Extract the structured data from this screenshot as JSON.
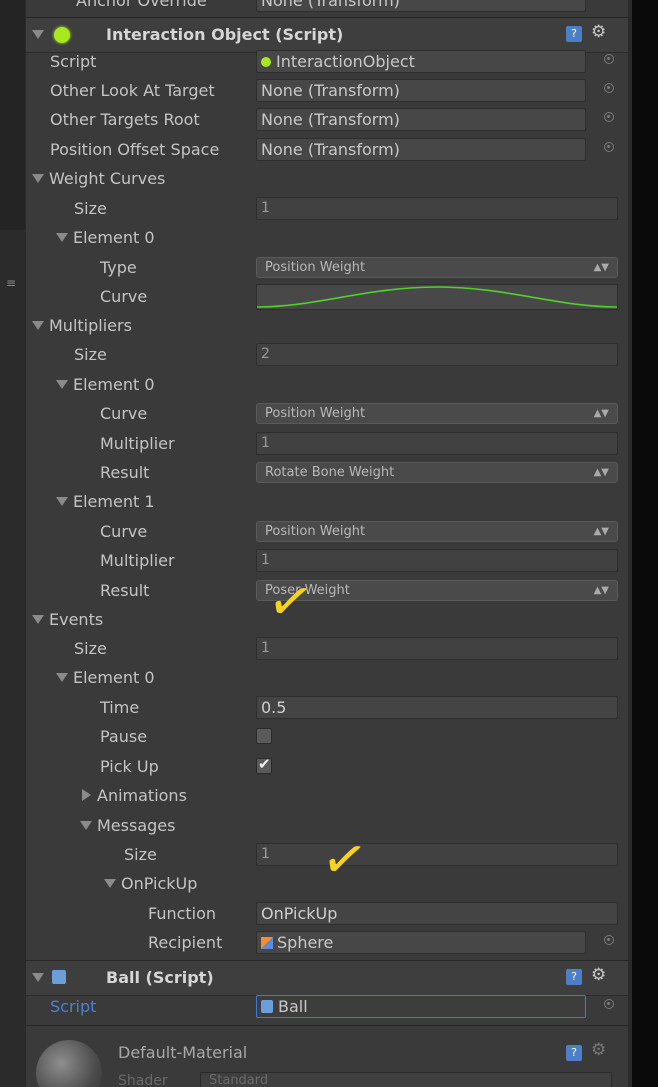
{
  "top_partial": {
    "label": "Anchor Override",
    "value": "None (Transform)"
  },
  "component1": {
    "title": "Interaction Object (Script)",
    "rows": [
      {
        "label": "Script",
        "value": "InteractionObject"
      },
      {
        "label": "Other Look At Target",
        "value": "None (Transform)"
      },
      {
        "label": "Other Targets Root",
        "value": "None (Transform)"
      },
      {
        "label": "Position Offset Space",
        "value": "None (Transform)"
      }
    ],
    "weight_curves": {
      "label": "Weight Curves",
      "size_label": "Size",
      "size": "1",
      "element0": {
        "label": "Element 0",
        "type_label": "Type",
        "type": "Position Weight",
        "curve_label": "Curve"
      }
    },
    "multipliers": {
      "label": "Multipliers",
      "size_label": "Size",
      "size": "2",
      "elements": [
        {
          "label": "Element 0",
          "curve_label": "Curve",
          "curve": "Position Weight",
          "multiplier_label": "Multiplier",
          "multiplier": "1",
          "result_label": "Result",
          "result": "Rotate Bone Weight"
        },
        {
          "label": "Element 1",
          "curve_label": "Curve",
          "curve": "Position Weight",
          "multiplier_label": "Multiplier",
          "multiplier": "1",
          "result_label": "Result",
          "result": "Poser Weight"
        }
      ]
    },
    "events": {
      "label": "Events",
      "size_label": "Size",
      "size": "1",
      "element0": {
        "label": "Element 0",
        "time_label": "Time",
        "time": "0.5",
        "pause_label": "Pause",
        "pause": false,
        "pickup_label": "Pick Up",
        "pickup": true,
        "animations_label": "Animations",
        "messages_label": "Messages",
        "messages_size_label": "Size",
        "messages_size": "1",
        "onpickup_label": "OnPickUp",
        "function_label": "Function",
        "function": "OnPickUp",
        "recipient_label": "Recipient",
        "recipient": "Sphere"
      }
    }
  },
  "component2": {
    "title": "Ball (Script)",
    "script_label": "Script",
    "script": "Ball"
  },
  "material": {
    "title": "Default-Material",
    "shader_label": "Shader",
    "shader": "Standard"
  },
  "colors": {
    "accent_green": "#a8e81e",
    "annotation_yellow": "#f5d31f",
    "selection_blue": "#3c7ad6"
  },
  "annotations": [
    "checkmark",
    "checkmark"
  ]
}
